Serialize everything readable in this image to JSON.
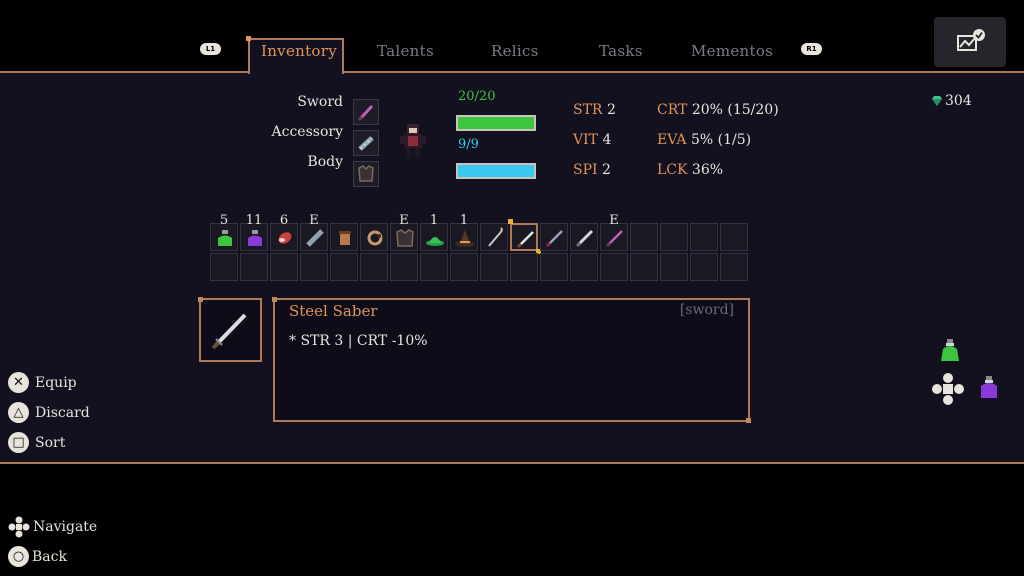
{
  "tabs": [
    {
      "label": "Inventory",
      "active": true
    },
    {
      "label": "Talents",
      "active": false
    },
    {
      "label": "Relics",
      "active": false
    },
    {
      "label": "Tasks",
      "active": false
    },
    {
      "label": "Mementos",
      "active": false
    }
  ],
  "shoulders": {
    "left": "L1",
    "right": "R1"
  },
  "equipment": {
    "sword_label": "Sword",
    "accessory_label": "Accessory",
    "body_label": "Body"
  },
  "vitals": {
    "hp": "20/20",
    "hp_fraction": 1.0,
    "mp": "9/9",
    "mp_fraction": 1.0
  },
  "stats": {
    "str_key": "STR",
    "str_val": "2",
    "vit_key": "VIT",
    "vit_val": "4",
    "spi_key": "SPI",
    "spi_val": "2",
    "crt_key": "CRT",
    "crt_val": "20% (15/20)",
    "eva_key": "EVA",
    "eva_val": "5% (1/5)",
    "lck_key": "LCK",
    "lck_val": "36%"
  },
  "currency": {
    "gems": "304"
  },
  "inventory": {
    "badges": [
      "5",
      "11",
      "6",
      "E",
      "",
      "",
      "E",
      "1",
      "1",
      "",
      "",
      "",
      "",
      "E"
    ],
    "selected_index": 10
  },
  "selected_item": {
    "name": "Steel Saber",
    "type": "[sword]",
    "description": "* STR 3 | CRT -10%"
  },
  "actions": {
    "equip": "Equip",
    "discard": "Discard",
    "sort": "Sort"
  },
  "nav": {
    "navigate": "Navigate",
    "back": "Back"
  },
  "colors": {
    "accent": "#e0935a",
    "frame": "#b07a56",
    "hp": "#3ec43e",
    "mp": "#3ac8f0"
  }
}
